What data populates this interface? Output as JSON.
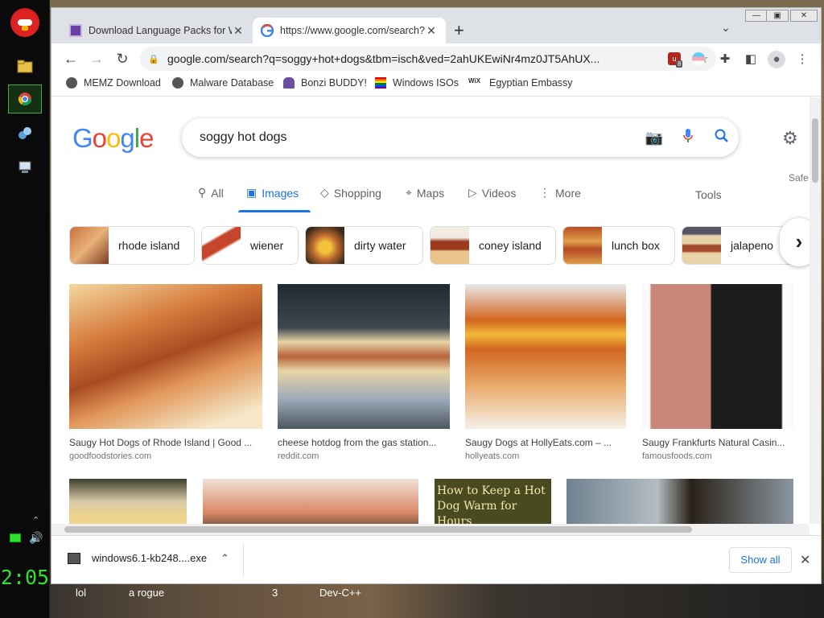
{
  "desktop": {
    "clock": "2:05",
    "taskbar_labels": [
      "lol",
      "a rogue",
      "3",
      "Dev-C++"
    ]
  },
  "browser": {
    "tabs": [
      {
        "title": "Download Language Packs for W",
        "active": false
      },
      {
        "title": "https://www.google.com/search?",
        "active": true
      }
    ],
    "url": "google.com/search?q=soggy+hot+dogs&tbm=isch&ved=2ahUKEwiNr4mz0JT5AhUX...",
    "extension_badge": "8",
    "bookmarks": [
      "MEMZ Download",
      "Malware Database",
      "Bonzi BUDDY!",
      "Windows ISOs",
      "Egyptian Embassy"
    ]
  },
  "google": {
    "logo": [
      "G",
      "o",
      "o",
      "g",
      "l",
      "e"
    ],
    "logo_colors": [
      "#4285f4",
      "#ea4335",
      "#fbbc05",
      "#4285f4",
      "#34a853",
      "#ea4335"
    ],
    "query": "soggy hot dogs",
    "tabs": [
      {
        "label": "All",
        "icon": "search-icon"
      },
      {
        "label": "Images",
        "icon": "image-icon"
      },
      {
        "label": "Shopping",
        "icon": "tag-icon"
      },
      {
        "label": "Maps",
        "icon": "map-pin-icon"
      },
      {
        "label": "Videos",
        "icon": "play-icon"
      },
      {
        "label": "More",
        "icon": "more-vert-icon"
      }
    ],
    "active_tab": "Images",
    "tools": "Tools",
    "safe": "Safe",
    "chips": [
      "rhode island",
      "wiener",
      "dirty water",
      "coney island",
      "lunch box",
      "jalapeno"
    ],
    "results": [
      {
        "title": "Saugy Hot Dogs of Rhode Island | Good ...",
        "source": "goodfoodstories.com"
      },
      {
        "title": "cheese hotdog from the gas station...",
        "source": "reddit.com"
      },
      {
        "title": "Saugy Dogs at HollyEats.com – ...",
        "source": "hollyeats.com"
      },
      {
        "title": "Saugy Frankfurts Natural Casin...",
        "source": "famousfoods.com"
      }
    ],
    "row2_overlay_text": "How to Keep a Hot Dog Warm for Hours"
  },
  "download_bar": {
    "filename": "windows6.1-kb248....exe",
    "show_all": "Show all"
  }
}
